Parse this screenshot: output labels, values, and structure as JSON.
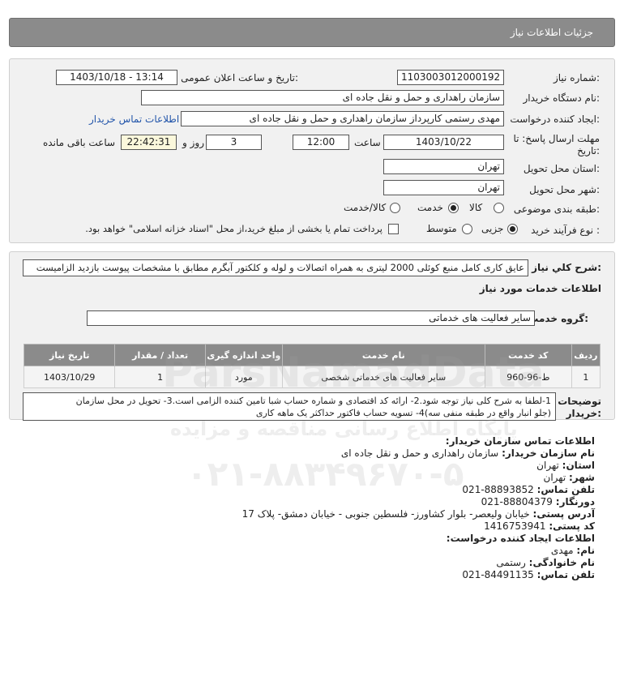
{
  "header": {
    "title": "جزئیات اطلاعات نیاز"
  },
  "form": {
    "need_number_label": "شماره نیاز:",
    "need_number": "1103003012000192",
    "announce_label": "تاریخ و ساعت اعلان عمومی:",
    "announce_value": "1403/10/18 - 13:14",
    "buyer_label": "نام دستگاه خریدار:",
    "buyer_value": "سازمان راهداری و حمل و نقل جاده ای",
    "creator_label": "ایجاد کننده درخواست:",
    "creator_value": "مهدی رستمی کارپرداز سازمان راهداری و حمل و نقل جاده ای",
    "contact_link": "اطلاعات تماس خریدار",
    "deadline_label_1": "مهلت ارسال پاسخ: تا",
    "deadline_label_2": "تاریخ:",
    "deadline_date": "1403/10/22",
    "time_label": "ساعت",
    "deadline_time": "12:00",
    "days_value": "3",
    "days_label": "روز و",
    "remaining_time": "22:42:31",
    "remaining_label": "ساعت باقی مانده",
    "province_label": "استان محل تحویل:",
    "province_value": "تهران",
    "city_label": "شهر محل تحویل:",
    "city_value": "تهران",
    "category_label": "طبقه بندی موضوعی:",
    "category_options": [
      "کالا",
      "خدمت",
      "کالا/خدمت"
    ],
    "category_selected": "خدمت",
    "process_label": "نوع فرآیند خرید :",
    "process_options": [
      "جزیی",
      "متوسط"
    ],
    "process_selected": "جزیی",
    "payment_text": "پرداخت تمام یا بخشی از مبلغ خرید،از محل \"اسناد خزانه اسلامی\" خواهد بود."
  },
  "summary": {
    "label": "شرح کلي نياز:",
    "text": "عایق کاری کامل منبع کوئلی 2000 لیتری به همراه اتصالات و لوله و کلکتور آبگرم مطابق با مشخصات پیوست بازدید الزامیست"
  },
  "services": {
    "section_title": "اطلاعات خدمات مورد نیاز",
    "group_label": "گروه خدمت:",
    "group_value": "سایر فعالیت های خدماتی",
    "columns": [
      "ردیف",
      "کد خدمت",
      "نام خدمت",
      "واحد اندازه گیری",
      "تعداد / مقدار",
      "تاریخ نیاز"
    ],
    "rows": [
      [
        "1",
        "ط-96-960",
        "سایر فعالیت های خدماتی شخصی",
        "مورد",
        "1",
        "1403/10/29"
      ]
    ]
  },
  "notes": {
    "label_1": "توضیحات",
    "label_2": "خریدار:",
    "line_1": "1-لطفا به شرح کلی نیاز توجه شود.2- ارائه کد اقتصادی و شماره حساب شبا تامین کننده الزامی است.3- تحویل در محل سازمان",
    "line_2": "(جلو انبار واقع در طبقه منفی سه)4- تسویه حساب فاکتور حداکثر یک ماهه کاری"
  },
  "buyer_info": {
    "title": "اطلاعات تماس سازمان خریدار:",
    "org_label": "نام سازمان خریدار:",
    "org_value": "سازمان راهداری و حمل و نقل جاده ای",
    "province_label": "استان:",
    "province_value": "تهران",
    "city_label": "شهر:",
    "city_value": "تهران",
    "phone_label": "تلفن تماس:",
    "phone_value": "021-88893852",
    "fax_label": "دورنگار:",
    "fax_value": "021-88804379",
    "address_label": "آدرس پستی:",
    "address_value": "خیابان ولیعصر- بلوار کشاورز- فلسطین جنوبی - خیابان دمشق- پلاک 17",
    "postal_label": "کد پستی:",
    "postal_value": "1416753941"
  },
  "creator_info": {
    "title": "اطلاعات ایجاد کننده درخواست:",
    "name_label": "نام:",
    "name_value": "مهدی",
    "family_label": "نام خانوادگی:",
    "family_value": "رستمی",
    "phone_label": "تلفن تماس:",
    "phone_value": "021-84491135"
  },
  "watermark": {
    "brand": "ParsNamadData",
    "tagline": "پایگاه اطلاع رسانی مناقصه و مزایده",
    "phone": "۰۲۱-۸۸۳۴۹۶۷۰-۵"
  }
}
